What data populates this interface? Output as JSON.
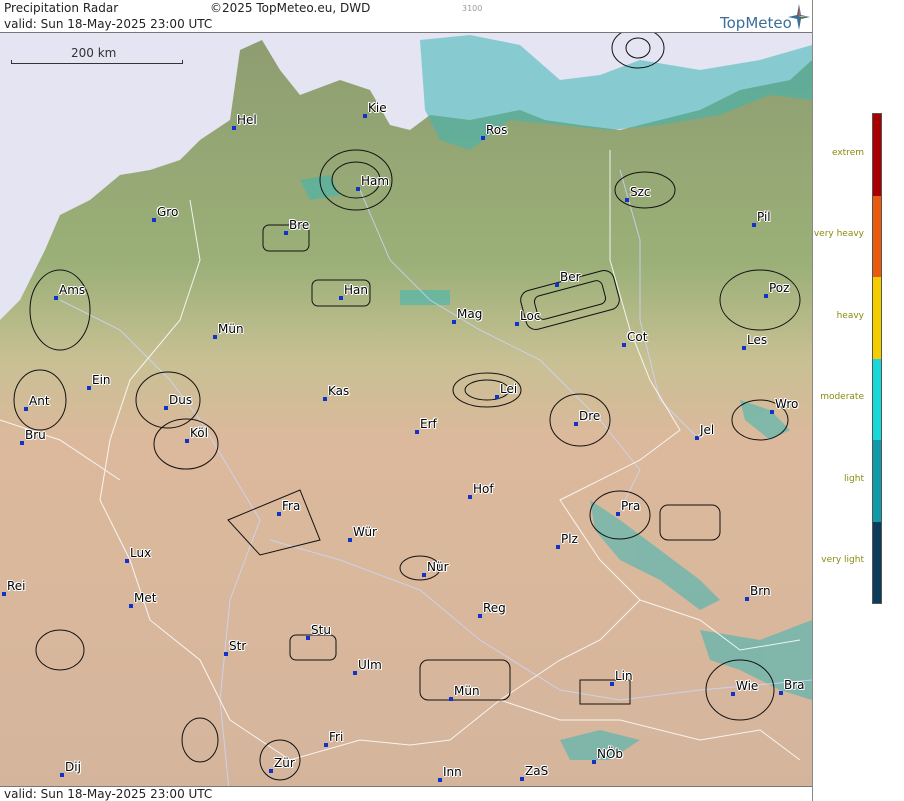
{
  "header": {
    "title": "Precipitation Radar",
    "copyright": "©2025 TopMeteo.eu, DWD",
    "valid_top": "valid:  Sun  18-May-2025 23:00 UTC",
    "badge": "3100",
    "logo": "TopMeteo"
  },
  "footer": {
    "valid_bottom": "valid:  Sun  18-May-2025 23:00 UTC"
  },
  "scale": {
    "label": "200 km"
  },
  "colors": {
    "sea": "#e4e4f2",
    "lowland": "#8fa070",
    "hills": "#d9b59a",
    "city_dot": "#1133cc",
    "radar_echo": "#3ab6b6",
    "legend_text": "#8a8a10"
  },
  "cities": [
    {
      "name": "Hel"
    },
    {
      "name": "Kie"
    },
    {
      "name": "Ros"
    },
    {
      "name": "Ham"
    },
    {
      "name": "Szc"
    },
    {
      "name": "Gro"
    },
    {
      "name": "Bre"
    },
    {
      "name": "Pil"
    },
    {
      "name": "Ams"
    },
    {
      "name": "Ber"
    },
    {
      "name": "Han"
    },
    {
      "name": "Poz"
    },
    {
      "name": "Mag"
    },
    {
      "name": "Loc"
    },
    {
      "name": "Mün"
    },
    {
      "name": "Cot"
    },
    {
      "name": "Les"
    },
    {
      "name": "Ein"
    },
    {
      "name": "Kas"
    },
    {
      "name": "Lei"
    },
    {
      "name": "Ant"
    },
    {
      "name": "Dus"
    },
    {
      "name": "Wro"
    },
    {
      "name": "Dre"
    },
    {
      "name": "Erf"
    },
    {
      "name": "Bru"
    },
    {
      "name": "Köl"
    },
    {
      "name": "Jel"
    },
    {
      "name": "Hof"
    },
    {
      "name": "Fra"
    },
    {
      "name": "Pra"
    },
    {
      "name": "Wür"
    },
    {
      "name": "Plz"
    },
    {
      "name": "Lux"
    },
    {
      "name": "Nür"
    },
    {
      "name": "Rei"
    },
    {
      "name": "Met"
    },
    {
      "name": "Brn"
    },
    {
      "name": "Reg"
    },
    {
      "name": "Stu"
    },
    {
      "name": "Str"
    },
    {
      "name": "Ulm"
    },
    {
      "name": "Lin"
    },
    {
      "name": "Wie"
    },
    {
      "name": "Bra"
    },
    {
      "name": "Mün"
    },
    {
      "name": "Fri"
    },
    {
      "name": "NÖb"
    },
    {
      "name": "Dij"
    },
    {
      "name": "Zür"
    },
    {
      "name": "Inn"
    },
    {
      "name": "ZaS"
    }
  ],
  "legend": {
    "labels": [
      "extrem",
      "very heavy",
      "heavy",
      "moderate",
      "light",
      "very light"
    ],
    "colors": [
      "#a80000",
      "#e85a10",
      "#f5cc00",
      "#18d8d8",
      "#109aa8",
      "#0c3b5c"
    ]
  }
}
